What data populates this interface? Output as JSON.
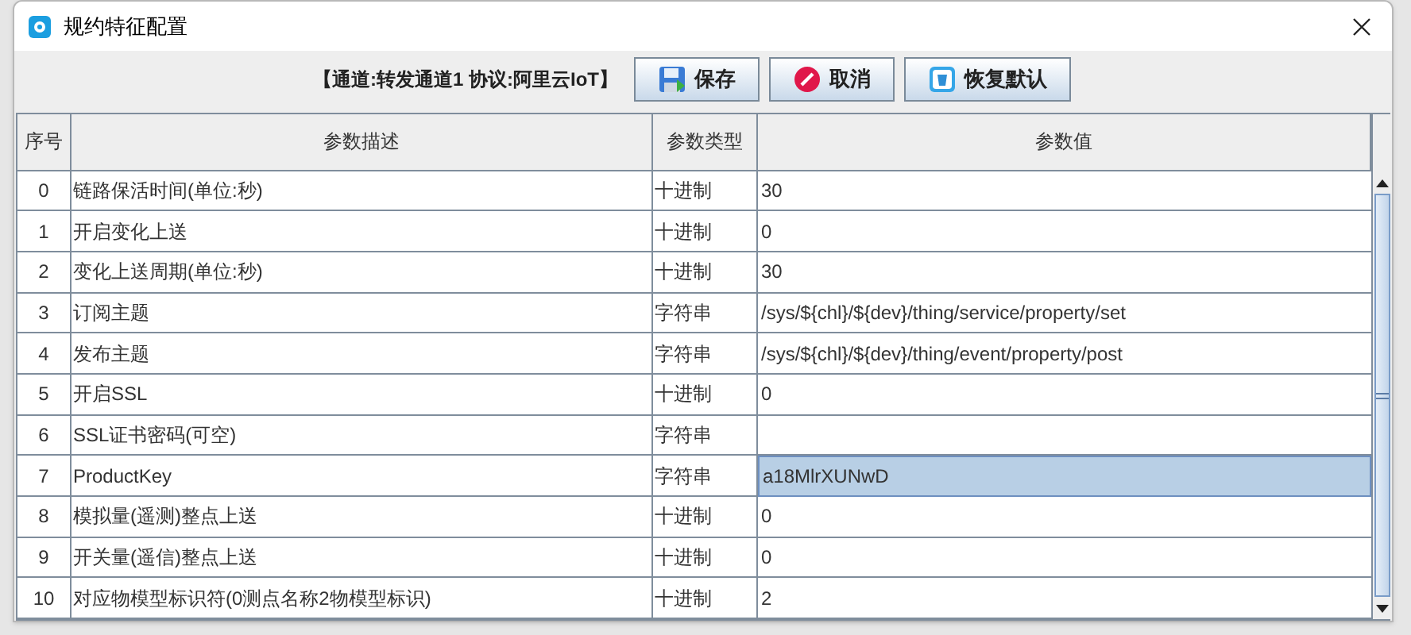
{
  "window": {
    "title": "规约特征配置"
  },
  "toolbar": {
    "info": "【通道:转发通道1  协议:阿里云IoT】",
    "buttons": [
      {
        "kind": "save",
        "label": "保存"
      },
      {
        "kind": "cancel",
        "label": "取消"
      },
      {
        "kind": "restore",
        "label": "恢复默认"
      }
    ]
  },
  "table": {
    "columns": [
      "序号",
      "参数描述",
      "参数类型",
      "参数值"
    ],
    "rows": [
      {
        "index": "0",
        "description": "链路保活时间(单位:秒)",
        "type": "十进制",
        "value": "30",
        "selected": false
      },
      {
        "index": "1",
        "description": "开启变化上送",
        "type": "十进制",
        "value": "0",
        "selected": false
      },
      {
        "index": "2",
        "description": "变化上送周期(单位:秒)",
        "type": "十进制",
        "value": "30",
        "selected": false
      },
      {
        "index": "3",
        "description": "订阅主题",
        "type": "字符串",
        "value": "/sys/${chl}/${dev}/thing/service/property/set",
        "selected": false
      },
      {
        "index": "4",
        "description": "发布主题",
        "type": "字符串",
        "value": "/sys/${chl}/${dev}/thing/event/property/post",
        "selected": false
      },
      {
        "index": "5",
        "description": "开启SSL",
        "type": "十进制",
        "value": "0",
        "selected": false
      },
      {
        "index": "6",
        "description": "SSL证书密码(可空)",
        "type": "字符串",
        "selected": false
      },
      {
        "index": "7",
        "description": "ProductKey",
        "type": "字符串",
        "value": "a18MlrXUNwD",
        "selected": true
      },
      {
        "index": "8",
        "description": "模拟量(遥测)整点上送",
        "type": "十进制",
        "value": "0",
        "selected": false
      },
      {
        "index": "9",
        "description": "开关量(遥信)整点上送",
        "type": "十进制",
        "value": "0",
        "selected": false
      },
      {
        "index": "10",
        "description": "对应物模型标识符(0测点名称2物模型标识)",
        "type": "十进制",
        "value": "2",
        "selected": false
      }
    ]
  }
}
